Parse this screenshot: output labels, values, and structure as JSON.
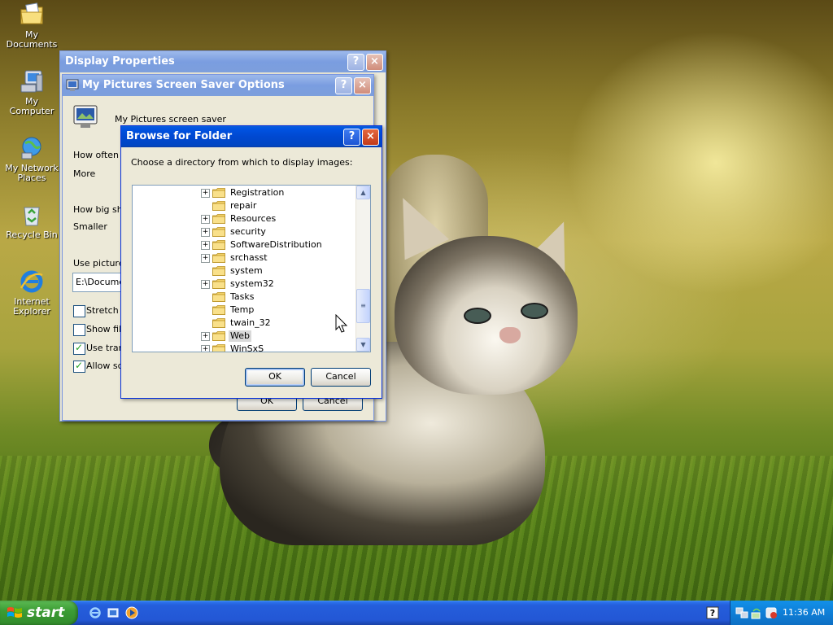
{
  "desktop": {
    "icons": [
      {
        "label": "My Documents"
      },
      {
        "label": "My Computer"
      },
      {
        "label": "My Network Places"
      },
      {
        "label": "Recycle Bin"
      },
      {
        "label": "Internet Explorer"
      }
    ]
  },
  "display_properties": {
    "title": "Display Properties",
    "help": "?",
    "close": "×"
  },
  "screensaver_options": {
    "title": "My Pictures Screen Saver Options",
    "help": "?",
    "close": "×",
    "heading": "My Pictures screen saver",
    "how_often": "How often s",
    "more": "More",
    "how_big": "How big sho",
    "smaller": "Smaller",
    "use_pictures": "Use pictures",
    "path_value": "E:\\Docume",
    "stretch": "Stretch s",
    "show_file": "Show file",
    "use_trans": "Use trans",
    "allow_scr": "Allow scr",
    "ok": "OK",
    "cancel": "Cancel"
  },
  "browse_folder": {
    "title": "Browse for Folder",
    "help": "?",
    "close": "×",
    "instruction": "Choose a directory from which to display images:",
    "items": [
      {
        "label": "Registration",
        "expand": "+"
      },
      {
        "label": "repair",
        "expand": ""
      },
      {
        "label": "Resources",
        "expand": "+"
      },
      {
        "label": "security",
        "expand": "+"
      },
      {
        "label": "SoftwareDistribution",
        "expand": "+"
      },
      {
        "label": "srchasst",
        "expand": "+"
      },
      {
        "label": "system",
        "expand": ""
      },
      {
        "label": "system32",
        "expand": "+"
      },
      {
        "label": "Tasks",
        "expand": ""
      },
      {
        "label": "Temp",
        "expand": ""
      },
      {
        "label": "twain_32",
        "expand": ""
      },
      {
        "label": "Web",
        "expand": "+",
        "selected": true
      },
      {
        "label": "WinSxS",
        "expand": "+"
      }
    ],
    "ok": "OK",
    "cancel": "Cancel"
  },
  "taskbar": {
    "start": "start",
    "clock": "11:36 AM"
  }
}
